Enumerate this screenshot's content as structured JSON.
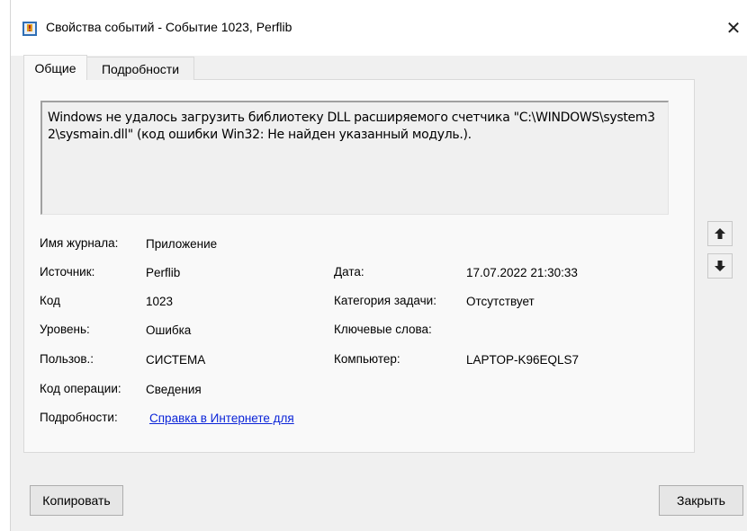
{
  "window": {
    "title": "Свойства событий - Событие 1023, Perflib",
    "close_label": "✕"
  },
  "tabs": [
    {
      "label": "Общие",
      "active": true
    },
    {
      "label": "Подробности",
      "active": false
    }
  ],
  "description": "Windows не удалось загрузить библиотеку DLL расширяемого счетчика \"C:\\WINDOWS\\system32\\sysmain.dll\" (код ошибки Win32: Не найден указанный модуль.).",
  "fields": {
    "log_name": {
      "label": "Имя журнала:",
      "value": "Приложение"
    },
    "source": {
      "label": "Источник:",
      "value": "Perflib"
    },
    "event_id": {
      "label": "Код",
      "value": "1023"
    },
    "level": {
      "label": "Уровень:",
      "value": "Ошибка"
    },
    "user": {
      "label": "Пользов.:",
      "value": "СИСТЕМА"
    },
    "opcode": {
      "label": "Код операции:",
      "value": "Сведения"
    },
    "more_info": {
      "label": "Подробности:",
      "value": "Справка в Интернете для"
    },
    "date": {
      "label": "Дата:",
      "value": "17.07.2022 21:30:33"
    },
    "task_category": {
      "label": "Категория задачи:",
      "value": "Отсутствует"
    },
    "keywords": {
      "label": "Ключевые слова:",
      "value": ""
    },
    "computer": {
      "label": "Компьютер:",
      "value": "LAPTOP-K96EQLS7"
    }
  },
  "buttons": {
    "copy": "Копировать",
    "close": "Закрыть"
  },
  "icons": {
    "app": "event-viewer-icon",
    "up": "arrow-up-icon",
    "down": "arrow-down-icon"
  }
}
